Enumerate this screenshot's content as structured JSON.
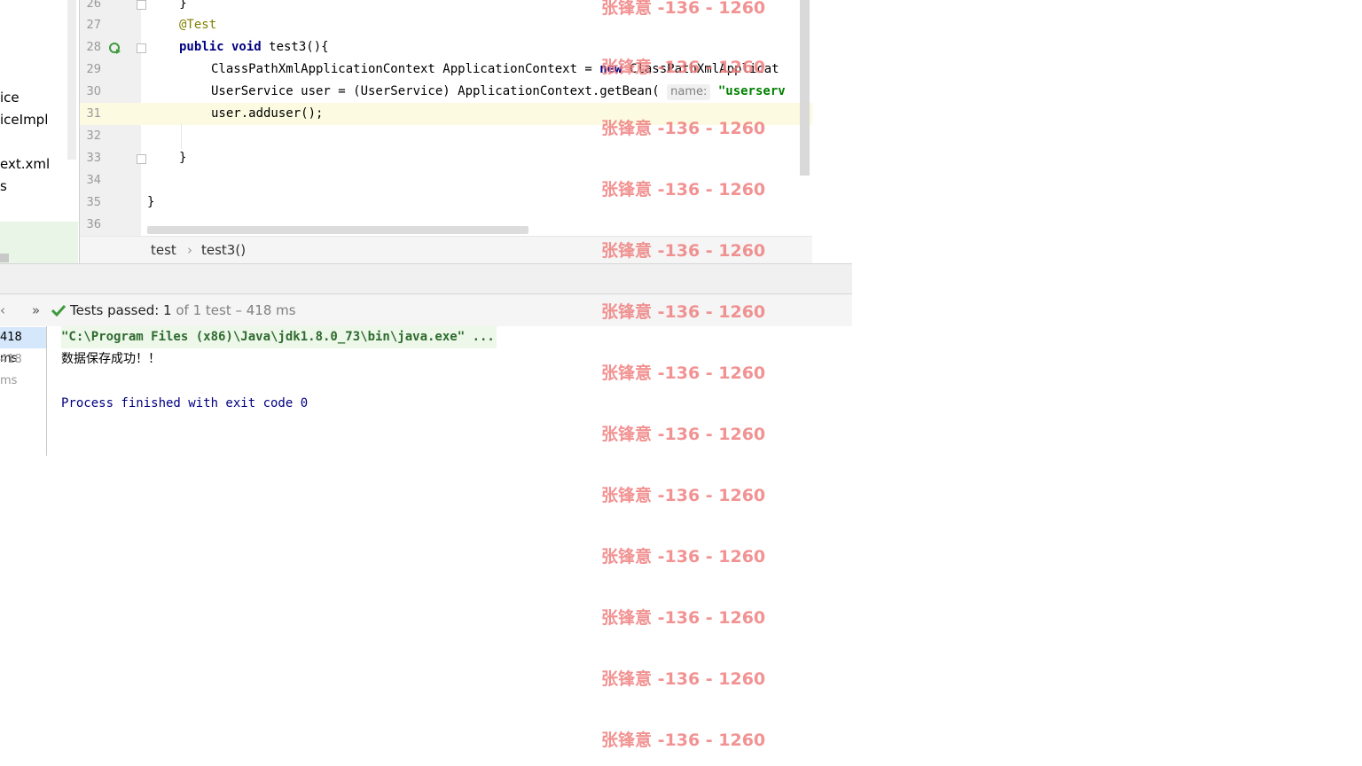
{
  "project_tree": {
    "items": [
      "ice",
      "iceImpl",
      "ext.xml",
      "s"
    ]
  },
  "editor": {
    "lines": [
      {
        "num": "26",
        "code": "}"
      },
      {
        "num": "27",
        "code": "@Test"
      },
      {
        "num": "28",
        "code_kw": "public void",
        "code_rest": " test3(){"
      },
      {
        "num": "29",
        "code_a": "ClassPathXmlApplicationContext ApplicationContext = ",
        "code_kw": "new",
        "code_b": " ClassPathXmlApplicat"
      },
      {
        "num": "30",
        "code_a": "UserService user = (UserService) ApplicationContext.getBean( ",
        "hint": "name:",
        "code_str": "\"userserv"
      },
      {
        "num": "31",
        "code": "user.adduser();"
      },
      {
        "num": "32",
        "code": ""
      },
      {
        "num": "33",
        "code": "}"
      },
      {
        "num": "34",
        "code": ""
      },
      {
        "num": "35",
        "code": "}"
      },
      {
        "num": "36",
        "code": ""
      }
    ],
    "breadcrumb": [
      "test",
      "test3()"
    ]
  },
  "run": {
    "toolbar": {
      "expand": "»",
      "status_bold": "Tests passed:",
      "status_count": " 1",
      "status_rest": " of 1 test – 418 ms"
    },
    "timings": [
      "418 ms",
      "418 ms"
    ],
    "console": {
      "command": "\"C:\\Program Files (x86)\\Java\\jdk1.8.0_73\\bin\\java.exe\" ...",
      "output": "数据保存成功！！",
      "exit": "Process finished with exit code 0"
    }
  },
  "watermark": {
    "text": "张锋意 -136 - 1260"
  },
  "colors": {
    "keyword": "#000080",
    "annotation": "#808000",
    "watermark": "#f08080",
    "test_pass": "#3c9a3c",
    "console_blue": "#000080"
  }
}
